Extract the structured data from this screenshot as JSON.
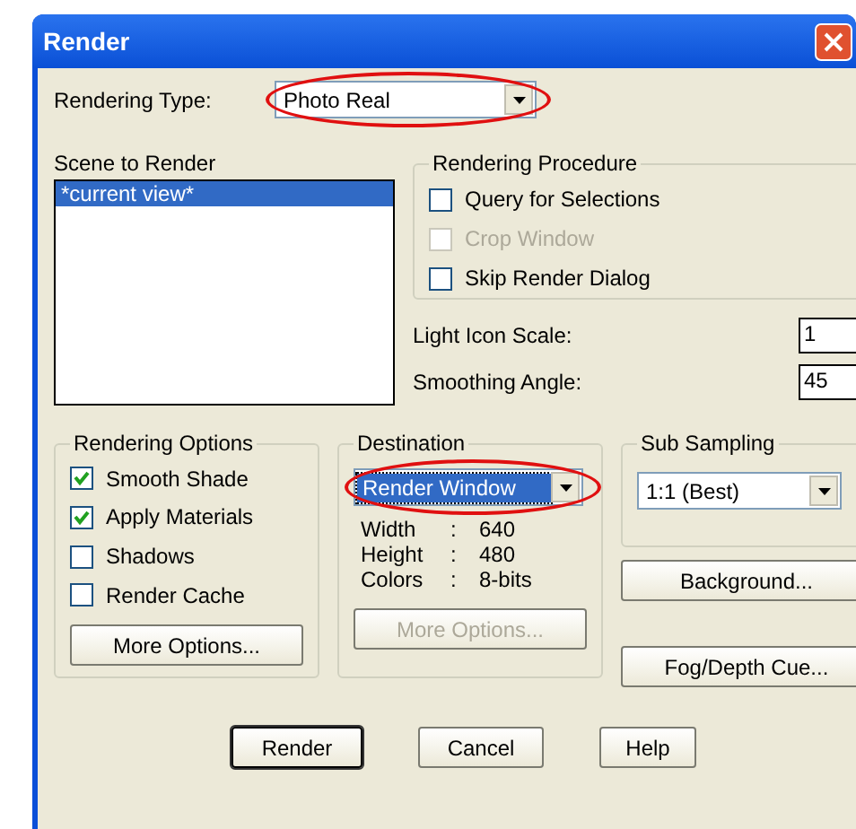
{
  "window": {
    "title": "Render"
  },
  "rendering_type": {
    "label": "Rendering Type:",
    "value": "Photo Real",
    "highlighted": true
  },
  "scene_list": {
    "label": "Scene to Render",
    "items": [
      {
        "text": "*current view*",
        "selected": true
      }
    ]
  },
  "rendering_procedure": {
    "title": "Rendering Procedure",
    "options": [
      {
        "label": "Query for Selections",
        "checked": false,
        "disabled": false
      },
      {
        "label": "Crop Window",
        "checked": false,
        "disabled": true
      },
      {
        "label": "Skip Render Dialog",
        "checked": false,
        "disabled": false
      }
    ]
  },
  "fields": [
    {
      "label": "Light Icon Scale:",
      "value": "1"
    },
    {
      "label": "Smoothing Angle:",
      "value": "45"
    }
  ],
  "rendering_options": {
    "title": "Rendering Options",
    "options": [
      {
        "label": "Smooth Shade",
        "checked": true,
        "disabled": false
      },
      {
        "label": "Apply Materials",
        "checked": true,
        "disabled": false
      },
      {
        "label": "Shadows",
        "checked": false,
        "disabled": false
      },
      {
        "label": "Render Cache",
        "checked": false,
        "disabled": false
      }
    ],
    "button": {
      "label": "More Options...",
      "disabled": false
    }
  },
  "destination": {
    "title": "Destination",
    "dropdown": {
      "value": "Render Window",
      "focused": true,
      "highlighted": true
    },
    "info": [
      {
        "name": "Width",
        "sep": ":",
        "value": "640"
      },
      {
        "name": "Height",
        "sep": ":",
        "value": "480"
      },
      {
        "name": "Colors",
        "sep": ":",
        "value": "8-bits"
      }
    ],
    "button": {
      "label": "More Options...",
      "disabled": true
    }
  },
  "sub_sampling": {
    "title": "Sub Sampling",
    "dropdown": {
      "value": "1:1 (Best)",
      "focused": false,
      "highlighted": false
    },
    "buttons": [
      {
        "label": "Background..."
      },
      {
        "label": "Fog/Depth Cue..."
      }
    ]
  },
  "buttons": [
    {
      "label": "Render",
      "default": true
    },
    {
      "label": "Cancel",
      "default": false
    },
    {
      "label": "Help",
      "default": false
    }
  ]
}
